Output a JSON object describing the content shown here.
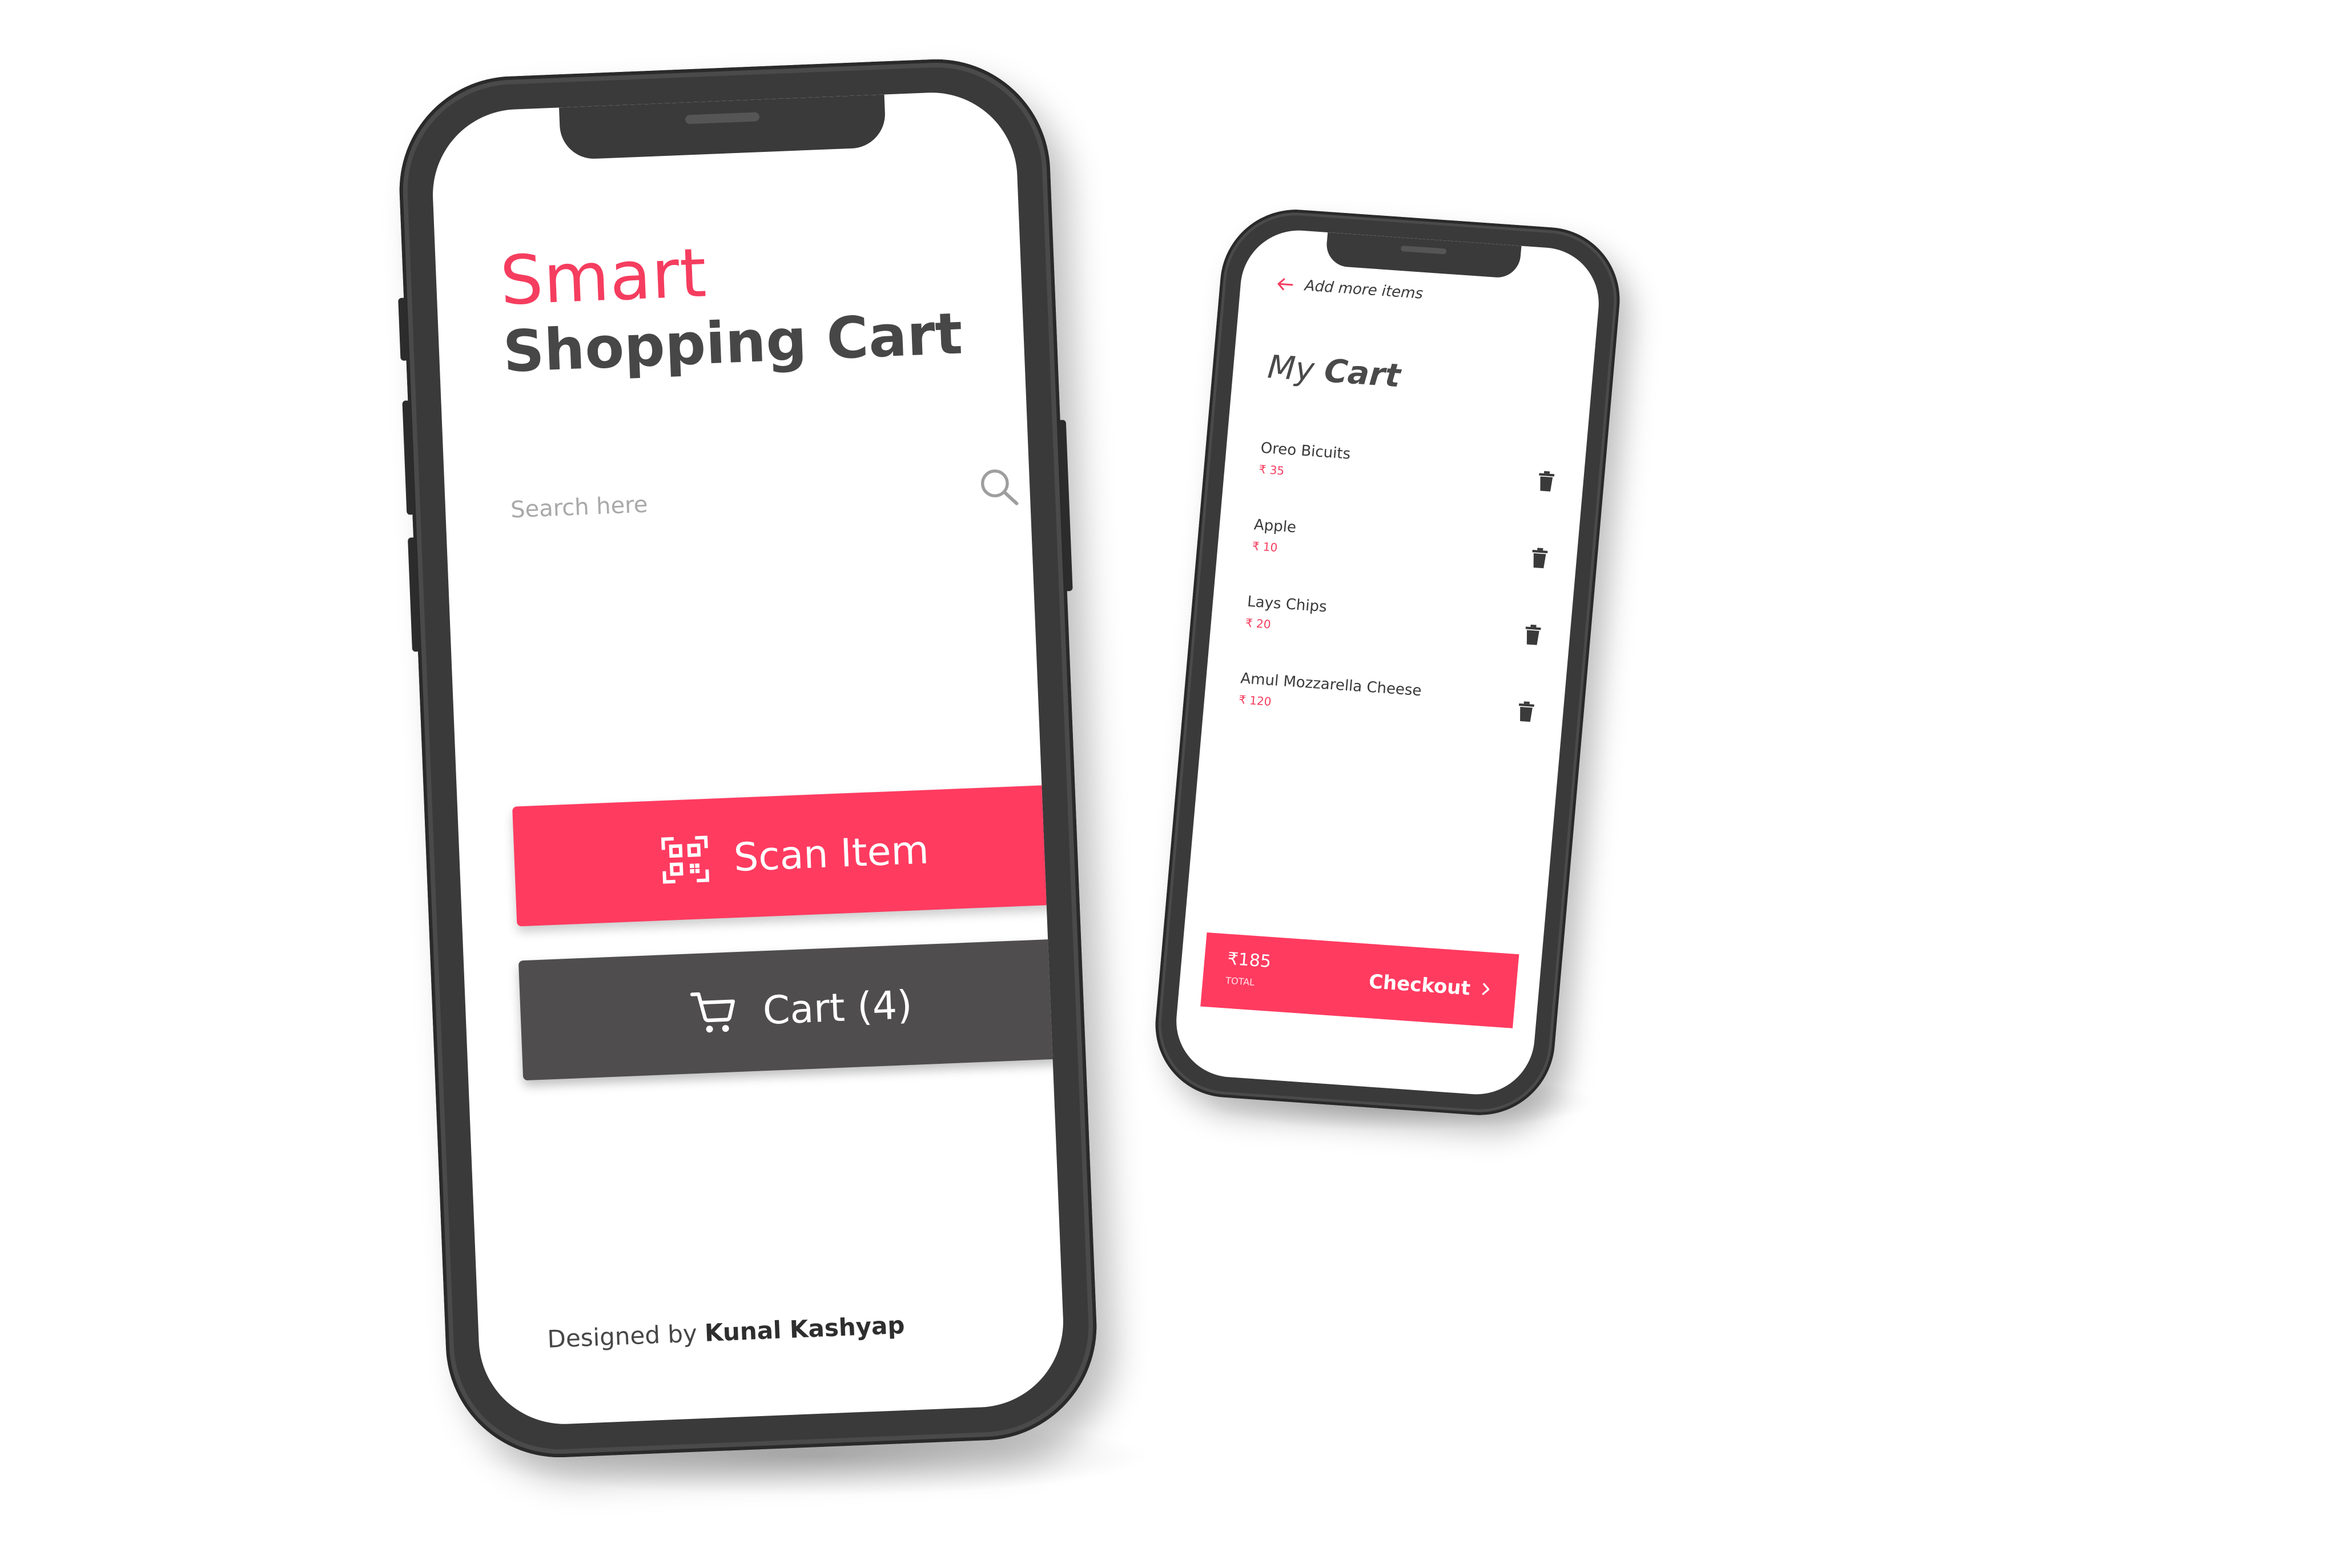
{
  "main_screen": {
    "title_line1": "Smart",
    "title_line2": "Shopping Cart",
    "search": {
      "placeholder": "Search here",
      "value": ""
    },
    "scan_button_label": "Scan Item",
    "cart_button_label": "Cart (4)",
    "footer_prefix": "Designed by",
    "footer_author": "Kunal Kashyap",
    "icons": {
      "search": "search-icon",
      "scan": "qr-scan-icon",
      "cart": "shopping-cart-icon"
    }
  },
  "cart_screen": {
    "back_label": "Add more items",
    "title_prefix": "My",
    "title_main": "Cart",
    "items": [
      {
        "name": "Oreo Bicuits",
        "price": "₹ 35"
      },
      {
        "name": "Apple",
        "price": "₹ 10"
      },
      {
        "name": "Lays Chips",
        "price": "₹ 20"
      },
      {
        "name": "Amul Mozzarella Cheese",
        "price": "₹ 120"
      }
    ],
    "total_amount": "₹185",
    "total_label": "TOTAL",
    "checkout_label": "Checkout",
    "icons": {
      "back": "arrow-left-icon",
      "delete": "trash-icon",
      "checkout": "chevron-right-icon"
    }
  },
  "colors": {
    "accent": "#ff3b60",
    "dark_button": "#4f4d4d",
    "heading": "#474747",
    "phone_frame": "#3a3a3a"
  }
}
